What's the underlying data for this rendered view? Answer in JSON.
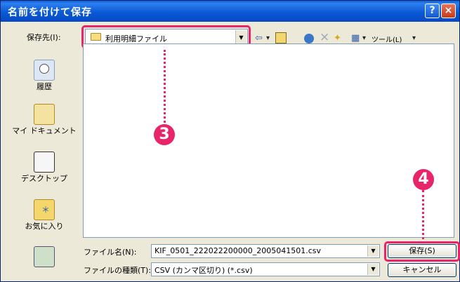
{
  "window": {
    "title": "名前を付けて保存",
    "help": "?",
    "close": "×"
  },
  "savein": {
    "label": "保存先(I):",
    "value": "利用明細ファイル",
    "dropdown_arrow": "▼"
  },
  "toolbar": {
    "back": "⇦",
    "back_dd": "▾",
    "up": "⬚",
    "search": "●",
    "delete": "×",
    "newfolder": "✦",
    "view": "▦",
    "view_dd": "▾",
    "tools_label": "ツール(L)",
    "tools_dd": "▾"
  },
  "places": [
    {
      "label": "履歴",
      "icon": "history-icon"
    },
    {
      "label": "マイ ドキュメント",
      "icon": "my-documents-icon"
    },
    {
      "label": "デスクトップ",
      "icon": "desktop-icon"
    },
    {
      "label": "お気に入り",
      "icon": "favorites-icon"
    },
    {
      "label": "",
      "icon": "my-network-icon"
    }
  ],
  "filename": {
    "label": "ファイル名(N):",
    "value": "KIF_0501_222022200000_2005041501.csv"
  },
  "filetype": {
    "label": "ファイルの種類(T):",
    "value": "CSV (カンマ区切り) (*.csv)"
  },
  "buttons": {
    "save": "保存(S)",
    "cancel": "キャンセル"
  },
  "annotations": {
    "step3": "3",
    "step4": "4",
    "color": "#e8256a"
  }
}
